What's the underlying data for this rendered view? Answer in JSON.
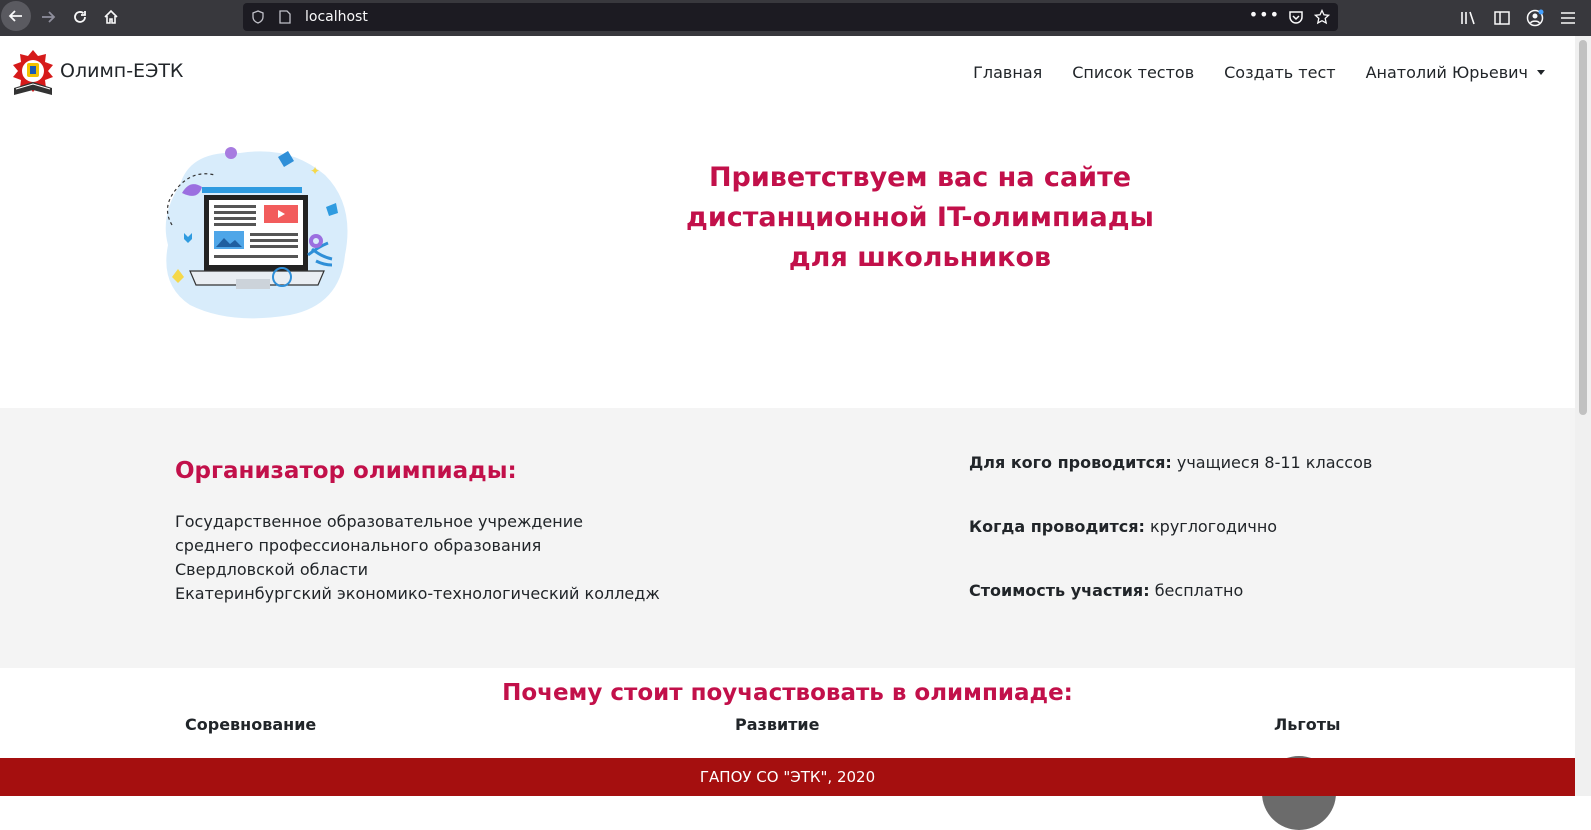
{
  "browser": {
    "url": "localhost",
    "icons": [
      "back-icon",
      "forward-icon",
      "reload-icon",
      "home-icon",
      "shield-icon",
      "page-icon",
      "more-icon",
      "pocket-icon",
      "star-icon",
      "library-icon",
      "sidebar-icon",
      "account-icon",
      "menu-icon"
    ]
  },
  "navbar": {
    "brand": "Олимп-ЕЭТК",
    "links": [
      "Главная",
      "Список тестов",
      "Создать тест",
      "Анатолий Юрьевич"
    ]
  },
  "hero": {
    "title_lines": [
      "Приветствуем вас на сайте",
      "дистанционной IT-олимпиады",
      "для школьников"
    ]
  },
  "organizer": {
    "title": "Организатор олимпиады:",
    "lines": [
      "Государственное образовательное учреждение",
      "среднего профессионального образования",
      "Свердловской области",
      "Екатеринбургский экономико-технологический колледж"
    ]
  },
  "facts": [
    {
      "label": "Для кого проводится:",
      "value": "учащиеся 8-11 классов"
    },
    {
      "label": "Когда проводится:",
      "value": "круглогодично"
    },
    {
      "label": "Стоимость участия:",
      "value": "бесплатно"
    }
  ],
  "why": {
    "title": "Почему стоит поучаствовать в олимпиаде:",
    "columns": [
      "Соревнование",
      "Развитие",
      "Льготы"
    ]
  },
  "footer": {
    "text": "ГАПОУ СО \"ЭТК\", 2020"
  },
  "colors": {
    "accent": "#c2104a",
    "footer_bg": "#a50f0f",
    "info_bg": "#f4f4f4",
    "chrome_bg": "#38383d"
  }
}
